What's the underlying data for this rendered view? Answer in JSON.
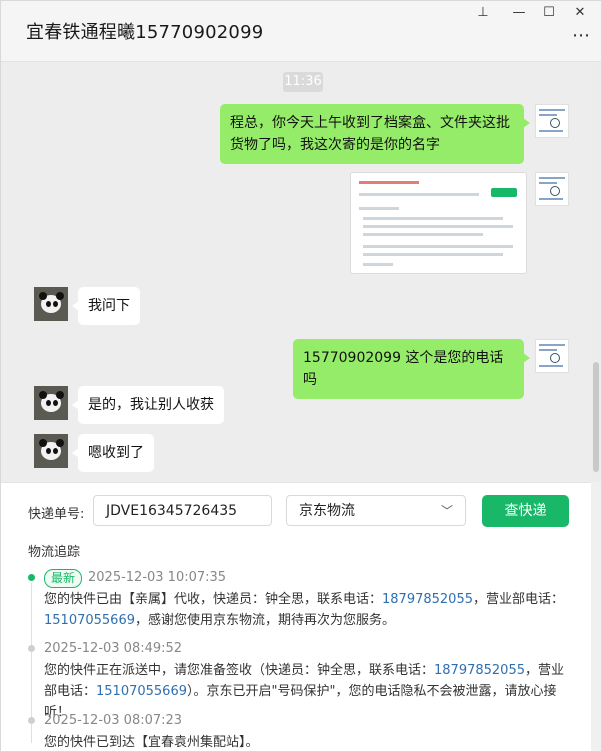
{
  "window": {
    "title": "宜春铁通程曦15770902099",
    "controls": {
      "pin": "⊥",
      "minimize": "—",
      "maximize": "☐",
      "close": "✕"
    },
    "more": "⋯"
  },
  "chat": {
    "timestamp": "11:36",
    "messages": [
      {
        "from": "me",
        "text": "程总，你今天上午收到了档案盒、文件夹这批货物了吗，我这次寄的是你的名字"
      },
      {
        "from": "me",
        "type": "image"
      },
      {
        "from": "them",
        "text": "我问下"
      },
      {
        "from": "me",
        "text": "15770902099  这个是您的电话吗"
      },
      {
        "from": "them",
        "text": "是的，我让别人收获"
      },
      {
        "from": "them",
        "text": "嗯收到了"
      }
    ]
  },
  "tracker": {
    "number_label": "快递单号:",
    "number_value": "JDVE16345726435",
    "carrier": "京东物流",
    "query_button": "查快递",
    "section_title": "物流追踪",
    "latest_badge": "最新",
    "events": [
      {
        "time": "2025-12-03 10:07:35",
        "parts": [
          "您的快件已由【亲属】代收，快递员：钟全思，联系电话：",
          "18797852055",
          "，营业部电话：",
          "15107055669",
          "，感谢您使用京东物流，期待再次为您服务。"
        ]
      },
      {
        "time": "2025-12-03 08:49:52",
        "parts": [
          "您的快件正在派送中，请您准备签收（快递员：钟全思，联系电话：",
          "18797852055",
          "，营业部电话：",
          "15107055669",
          "）。京东已开启\"号码保护\"，您的电话隐私不会被泄露，请放心接听！"
        ]
      },
      {
        "time": "2025-12-03 08:07:23",
        "parts": [
          "您的快件已到达【宜春袁州集配站】。"
        ]
      }
    ]
  },
  "colors": {
    "accent": "#19b868",
    "bubble_me": "#95ec69",
    "link": "#2f6fb0"
  }
}
